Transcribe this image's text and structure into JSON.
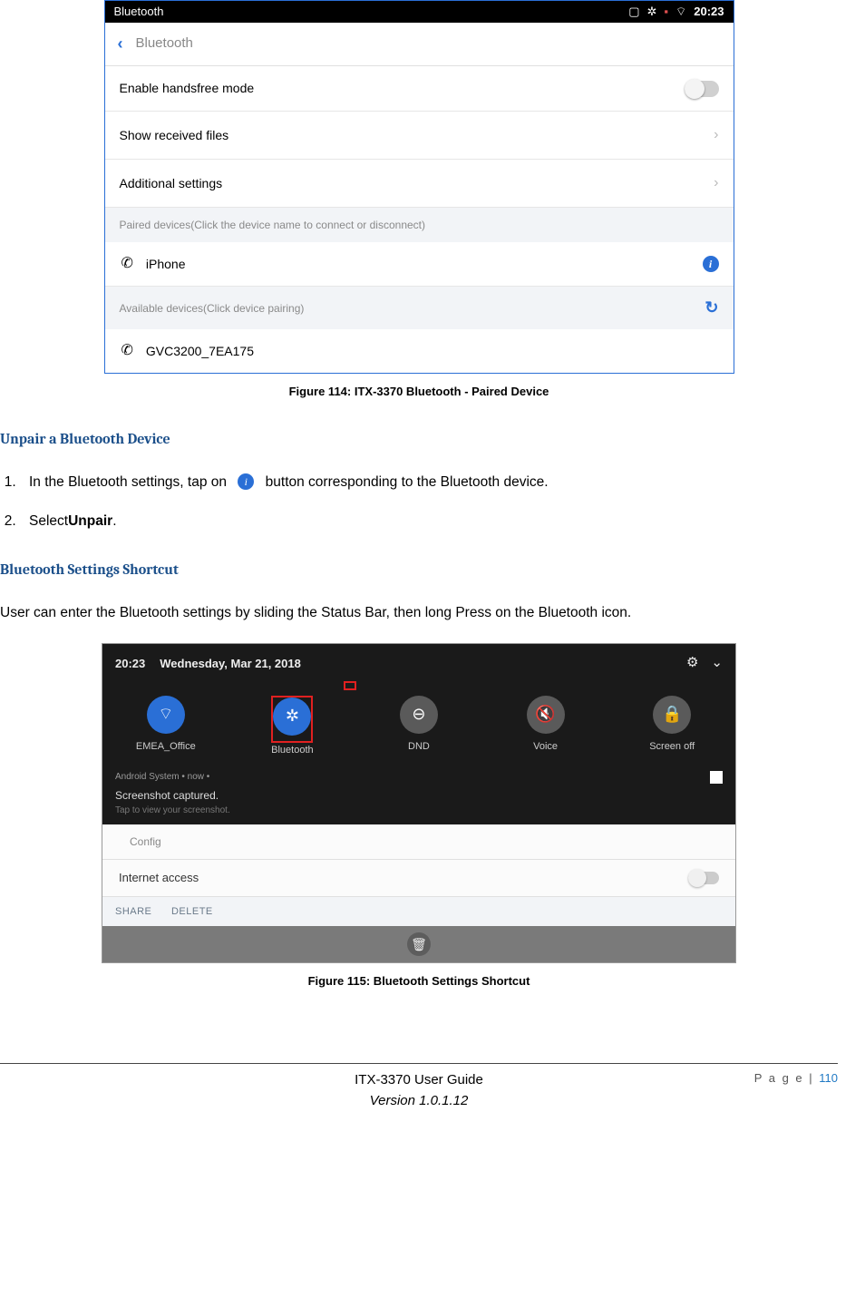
{
  "screenshot1": {
    "status_title": "Bluetooth",
    "status_time": "20:23",
    "nav_back_label": "Bluetooth",
    "row_handsfree": "Enable handsfree mode",
    "row_received": "Show received files",
    "row_additional": "Additional settings",
    "section_paired": "Paired devices(Click the device name to connect or disconnect)",
    "device_paired": "iPhone",
    "section_available": "Available devices(Click device pairing)",
    "device_available": "GVC3200_7EA175"
  },
  "caption1": "Figure 114: ITX-3370 Bluetooth - Paired Device",
  "heading_unpair": "Unpair a Bluetooth Device",
  "step1_pre": "In the Bluetooth settings, tap on",
  "step1_post": "button corresponding to the Bluetooth device.",
  "step2_pre": "Select",
  "step2_bold": "Unpair",
  "step2_post": ".",
  "heading_shortcut": "Bluetooth Settings Shortcut",
  "shortcut_para": "User can enter the Bluetooth settings by sliding the Status Bar, then long Press on the Bluetooth icon.",
  "screenshot2": {
    "time": "20:23",
    "date": "Wednesday, Mar 21, 2018",
    "tiles": {
      "wifi": "EMEA_Office",
      "bluetooth": "Bluetooth",
      "dnd": "DND",
      "voice": "Voice",
      "screenoff": "Screen off"
    },
    "notif_src": "Android System • now •",
    "notif_title": "Screenshot captured.",
    "notif_sub": "Tap to view your screenshot.",
    "list_config": "Config",
    "list_internet": "Internet access",
    "action_share": "SHARE",
    "action_delete": "DELETE"
  },
  "caption2": "Figure 115: Bluetooth Settings Shortcut",
  "footer": {
    "page_label": "P a g e",
    "page_sep": " | ",
    "page_num": "110",
    "doc_title": "ITX-3370 User Guide",
    "doc_version": "Version 1.0.1.12"
  }
}
